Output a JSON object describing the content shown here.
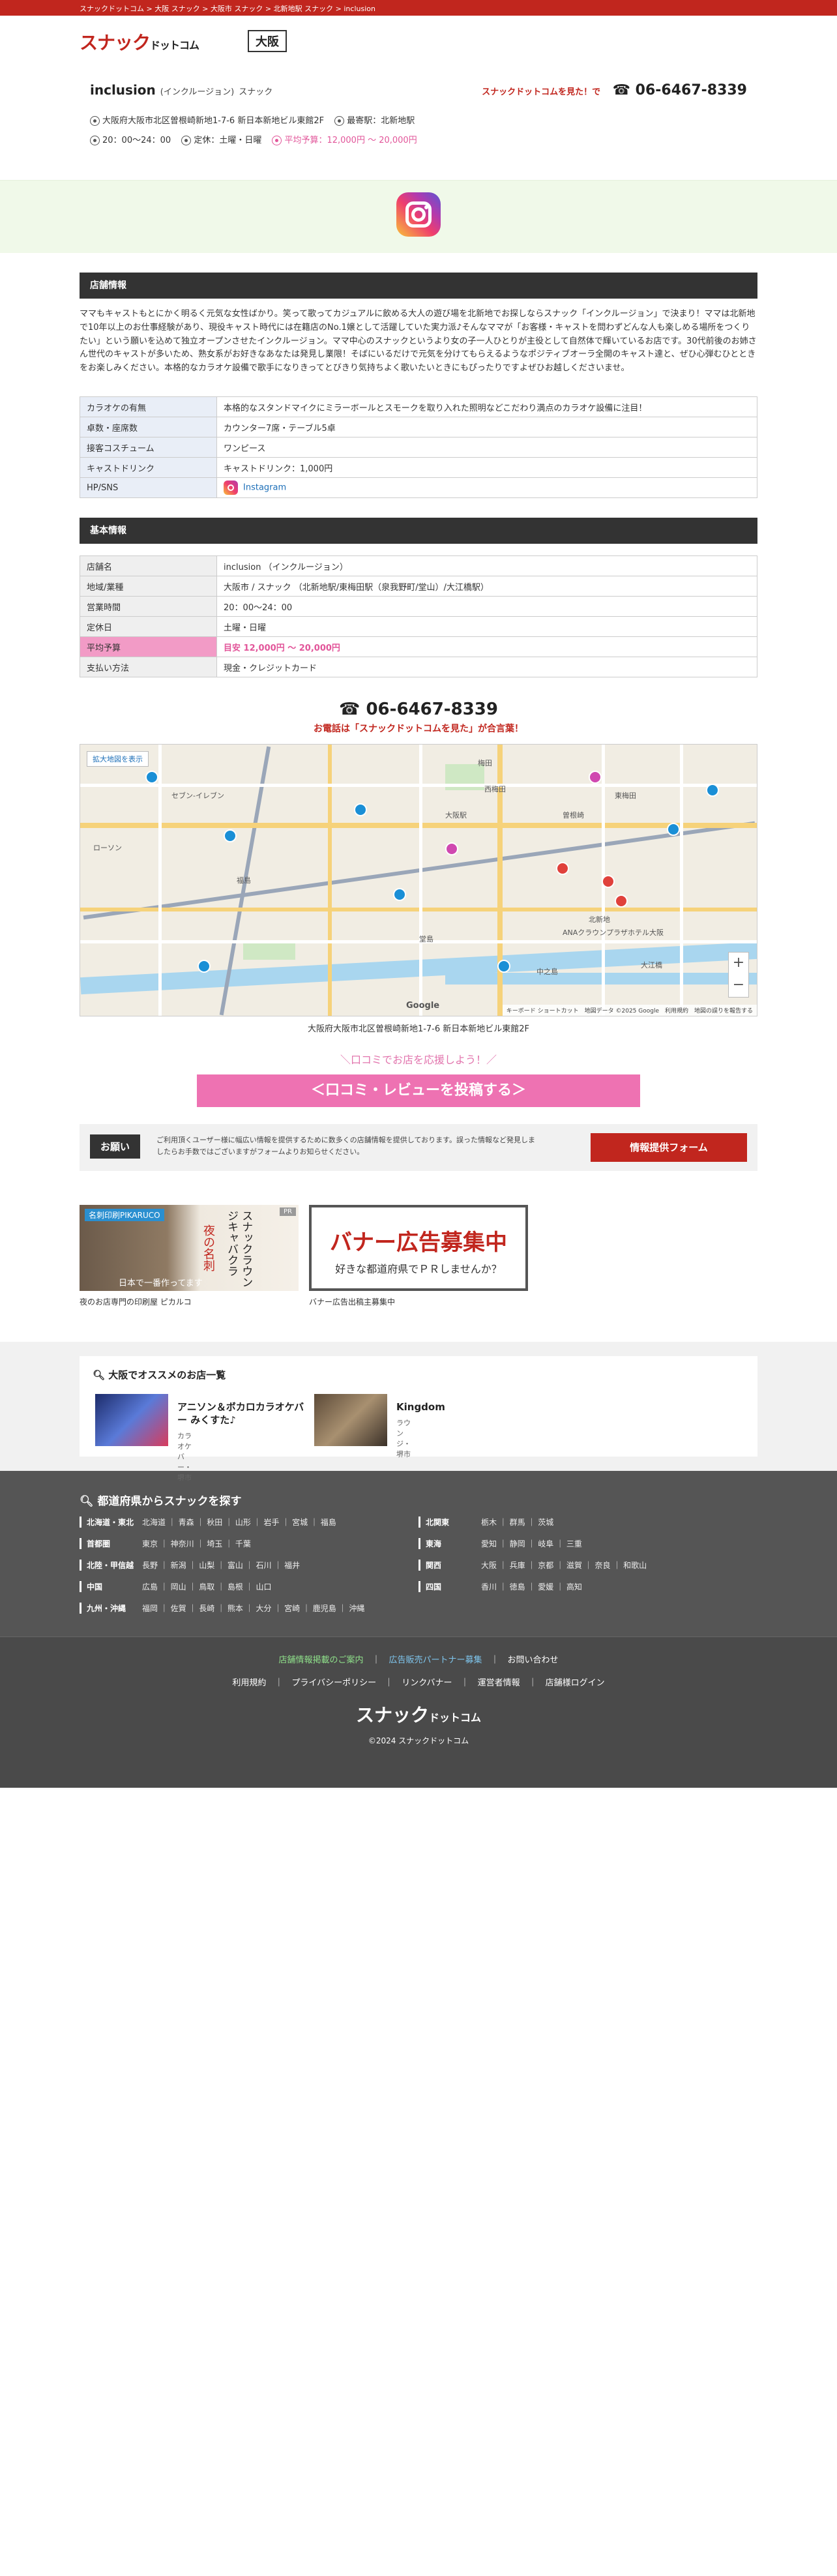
{
  "breadcrumb": [
    "スナックドットコム",
    "大阪 スナック",
    "大阪市 スナック",
    "北新地駅 スナック",
    "inclusion"
  ],
  "header": {
    "logo_main": "スナック",
    "logo_sub": "ドットコム",
    "region": "大阪"
  },
  "shop": {
    "name": "inclusion",
    "kana": "(インクルージョン)",
    "category": "スナック",
    "tel_note": "スナックドットコムを見た！で",
    "tel": "☎ 06-6467-8339",
    "address": "大阪府大阪市北区曽根崎新地1-7-6 新日本新地ビル東館2F",
    "station": "最寄駅：北新地駅",
    "hours": "20：00〜24：00",
    "holiday": "定休：土曜・日曜",
    "budget": "平均予算：12,000円 〜 20,000円"
  },
  "shop_info": {
    "heading": "店舗情報",
    "description": "ママもキャストもとにかく明るく元気な女性ばかり。笑って歌ってカジュアルに飲める大人の遊び場を北新地でお探しならスナック「インクルージョン」で決まり！ママは北新地で10年以上のお仕事経験があり、現役キャスト時代には在籍店のNo.1嬢として活躍していた実力派♪そんなママが「お客様・キャストを問わずどんな人も楽しめる場所をつくりたい」という願いを込めて独立オープンさせたインクルージョン。ママ中心のスナックというより女の子一人ひとりが主役として自然体で輝いているお店です。30代前後のお姉さん世代のキャストが多いため、熟女系がお好きなあなたは発見し業限！そばにいるだけで元気を分けてもらえるようなポジティブオーラ全開のキャスト達と、ぜひ心弾むひとときをお楽しみください。本格的なカラオケ設備で歌手になりきってとびきり気持ちよく歌いたいときにもぴったりですよぜひお越しくださいませ。",
    "rows": [
      {
        "key": "カラオケの有無",
        "value": "本格的なスタンドマイクにミラーボールとスモークを取り入れた照明などこだわり満点のカラオケ設備に注目！"
      },
      {
        "key": "卓数・座席数",
        "value": "カウンター7席・テーブル5卓"
      },
      {
        "key": "接客コスチューム",
        "value": "ワンピース"
      },
      {
        "key": "キャストドリンク",
        "value": "キャストドリンク：1,000円"
      },
      {
        "key": "HP/SNS",
        "value": "Instagram"
      }
    ]
  },
  "basic_info": {
    "heading": "基本情報",
    "rows": [
      {
        "key": "店舗名",
        "value": "inclusion （インクルージョン）"
      },
      {
        "key": "地域/業種",
        "value": "大阪市 / スナック （北新地駅/東梅田駅（泉我野町/堂山）/大江橋駅）"
      },
      {
        "key": "営業時間",
        "value": "20：00〜24：00"
      },
      {
        "key": "定休日",
        "value": "土曜・日曜"
      },
      {
        "key": "平均予算",
        "value": "目安 12,000円 〜 20,000円"
      },
      {
        "key": "支払い方法",
        "value": "現金・クレジットカード"
      }
    ]
  },
  "tel_block": {
    "number": "☎ 06-6467-8339",
    "call_note": "お電話は「スナックドットコムを見た」が合言葉！"
  },
  "map": {
    "expand": "拡大地図を表示",
    "google": "Google",
    "attribution": "キーボード ショートカット　地図データ ©2025 Google　利用規約　地図の誤りを報告する",
    "labels": [
      "梅田",
      "大阪駅",
      "北新地",
      "福島",
      "堂島",
      "中之島",
      "曽根崎",
      "西梅田",
      "東梅田",
      "大江橋",
      "ローソン",
      "セブン-イレブン",
      "ANAクラウンプラザホテル大阪"
    ],
    "address": "大阪府大阪市北区曽根崎新地1-7-6 新日本新地ビル東館2F"
  },
  "review": {
    "note": "＼口コミでお店を応援しよう！／",
    "button": "＜口コミ・レビューを投稿する＞"
  },
  "request": {
    "tag": "お願い",
    "text": "ご利用頂くユーザー様に幅広い情報を提供するために数多くの店舗情報を提供しております。誤った情報など発見しましたらお手数ではございますがフォームよりお知らせください。",
    "button": "情報提供フォーム"
  },
  "banners": [
    {
      "brand": "名刺印刷PIKARUCO",
      "vert_main": "スナックラウンジキャバクラ",
      "vert_sub": "夜の名刺",
      "japan": "日本で一番作ってます",
      "pr": "PR",
      "caption": "夜のお店専門の印刷屋 ピカルコ"
    },
    {
      "big": "バナー広告募集中",
      "small": "好きな都道府県でＰＲしませんか？",
      "caption": "バナー広告出稿主募集中"
    }
  ],
  "recommend": {
    "title": "大阪でオススメのお店一覧",
    "shops": [
      {
        "name": "アニソン＆ボカロカラオケバー みくすた♪",
        "type": "カラオケバー・堺市"
      },
      {
        "name": "Kingdom",
        "type": "ラウンジ・堺市"
      }
    ]
  },
  "area": {
    "title": "都道府県からスナックを探す",
    "left": [
      {
        "region": "北海道・東北",
        "prefs": "北海道 ｜ 青森 ｜ 秋田 ｜ 山形 ｜ 岩手 ｜ 宮城 ｜ 福島"
      },
      {
        "region": "首都圏",
        "prefs": "東京 ｜ 神奈川 ｜ 埼玉 ｜ 千葉"
      },
      {
        "region": "北陸・甲信越",
        "prefs": "長野 ｜ 新潟 ｜ 山梨 ｜ 富山 ｜ 石川 ｜ 福井"
      },
      {
        "region": "中国",
        "prefs": "広島 ｜ 岡山 ｜ 鳥取 ｜ 島根 ｜ 山口"
      },
      {
        "region": "九州・沖縄",
        "prefs": "福岡 ｜ 佐賀 ｜ 長崎 ｜ 熊本 ｜ 大分 ｜ 宮崎 ｜ 鹿児島 ｜ 沖縄"
      }
    ],
    "right": [
      {
        "region": "北関東",
        "prefs": "栃木 ｜ 群馬 ｜ 茨城"
      },
      {
        "region": "東海",
        "prefs": "愛知 ｜ 静岡 ｜ 岐阜 ｜ 三重"
      },
      {
        "region": "関西",
        "prefs": "大阪 ｜ 兵庫 ｜ 京都 ｜ 滋賀 ｜ 奈良 ｜ 和歌山"
      },
      {
        "region": "四国",
        "prefs": "香川 ｜ 徳島 ｜ 愛媛 ｜ 高知"
      }
    ]
  },
  "footer": {
    "link1": "店舗情報掲載のご案内",
    "link2": "広告販売パートナー募集",
    "link3": "お問い合わせ",
    "links": [
      "利用規約",
      "プライバシーポリシー",
      "リンクバナー",
      "運営者情報",
      "店舗様ログイン"
    ],
    "logo_main": "スナック",
    "logo_sub": "ドットコム",
    "copyright": "©2024 スナックドットコム"
  },
  "colors": {
    "brand_red": "#c1261e",
    "pink": "#ee72b2",
    "dark": "#333333"
  }
}
